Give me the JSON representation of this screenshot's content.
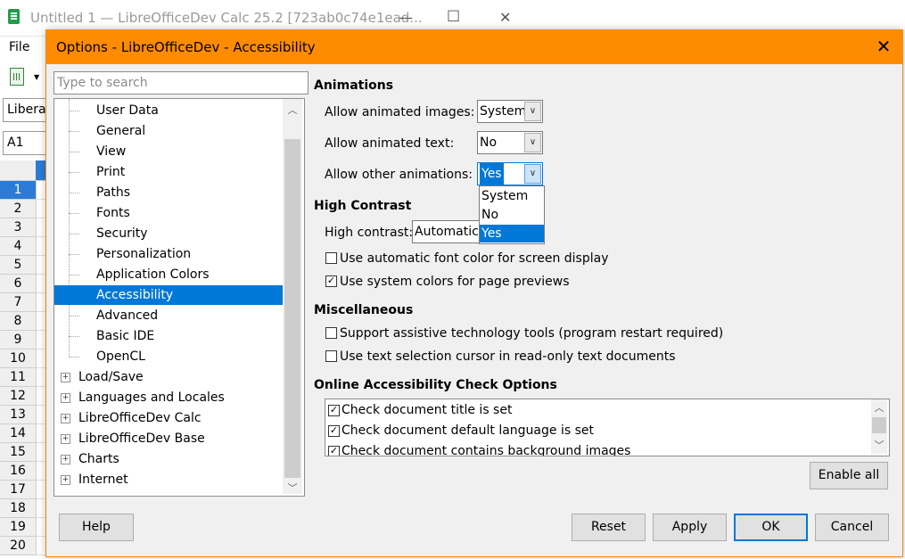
{
  "calc": {
    "title": "Untitled 1 — LibreOfficeDev Calc 25.2 [723ab0c74e1ead...",
    "minimize_glyph": "—",
    "maximize_glyph": "☐",
    "close_glyph": "✕",
    "menu_file": "File",
    "font_name": "Liberat",
    "name_box": "A1",
    "row_numbers": [
      "1",
      "2",
      "3",
      "4",
      "5",
      "6",
      "7",
      "8",
      "9",
      "10",
      "11",
      "12",
      "13",
      "14",
      "15",
      "16",
      "17",
      "18",
      "19",
      "20"
    ]
  },
  "dialog": {
    "title": "Options - LibreOfficeDev - Accessibility",
    "close_glyph": "✕",
    "accent_color": "#ff8c00",
    "search_placeholder": "Type to search",
    "tree": {
      "children": [
        "User Data",
        "General",
        "View",
        "Print",
        "Paths",
        "Fonts",
        "Security",
        "Personalization",
        "Application Colors",
        "Accessibility",
        "Advanced",
        "Basic IDE",
        "OpenCL"
      ],
      "selected": "Accessibility",
      "top_level": [
        "Load/Save",
        "Languages and Locales",
        "LibreOfficeDev Calc",
        "LibreOfficeDev Base",
        "Charts",
        "Internet"
      ]
    },
    "animations": {
      "title": "Animations",
      "images_label": "Allow animated images:",
      "images_value": "System",
      "text_label": "Allow animated text:",
      "text_value": "No",
      "other_label": "Allow other animations:",
      "other_value": "Yes",
      "other_options": [
        "System",
        "No",
        "Yes"
      ]
    },
    "high_contrast": {
      "title": "High Contrast",
      "label": "High contrast:",
      "value": "Automatic",
      "auto_font_color": {
        "label": "Use automatic font color for screen display",
        "checked": false
      },
      "system_colors": {
        "label": "Use system colors for page previews",
        "checked": true
      }
    },
    "misc": {
      "title": "Miscellaneous",
      "assistive": {
        "label": "Support assistive technology tools (program restart required)",
        "checked": false
      },
      "text_cursor": {
        "label": "Use text selection cursor in read-only text documents",
        "checked": false
      }
    },
    "online_check": {
      "title": "Online Accessibility Check Options",
      "items": [
        {
          "label": "Check document title is set",
          "checked": true
        },
        {
          "label": "Check document default language is set",
          "checked": true
        },
        {
          "label": "Check document contains background images",
          "checked": true
        }
      ],
      "enable_all": "Enable all"
    },
    "buttons": {
      "help": "Help",
      "reset": "Reset",
      "apply": "Apply",
      "ok": "OK",
      "cancel": "Cancel"
    },
    "check_glyph": "✓"
  }
}
